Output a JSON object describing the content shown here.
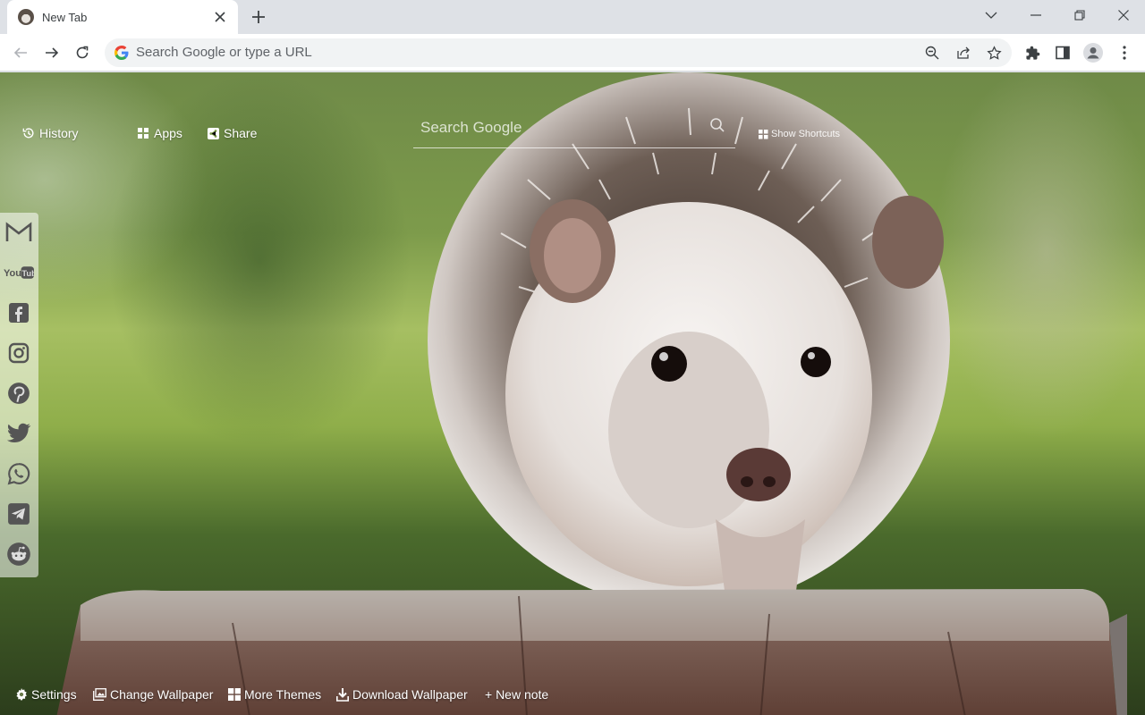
{
  "browser": {
    "tab": {
      "title": "New Tab"
    },
    "omnibox": {
      "placeholder": "Search Google or type a URL"
    },
    "icons": [
      "back-icon",
      "forward-icon",
      "reload-icon",
      "zoom-icon",
      "share-icon",
      "bookmark-star-icon",
      "extensions-icon",
      "side-panel-icon",
      "profile-icon",
      "menu-icon"
    ]
  },
  "newtab": {
    "links": {
      "history": "History",
      "apps": "Apps",
      "share": "Share"
    },
    "search_placeholder": "Search Google",
    "show_shortcuts": "Show Shortcuts",
    "social": [
      "gmail",
      "youtube",
      "facebook",
      "instagram",
      "pinterest",
      "twitter",
      "whatsapp",
      "telegram",
      "reddit"
    ],
    "bottom": {
      "settings": "Settings",
      "change_wallpaper": "Change Wallpaper",
      "more_themes": "More Themes",
      "download_wallpaper": "Download Wallpaper",
      "new_note": "+ New note"
    }
  }
}
